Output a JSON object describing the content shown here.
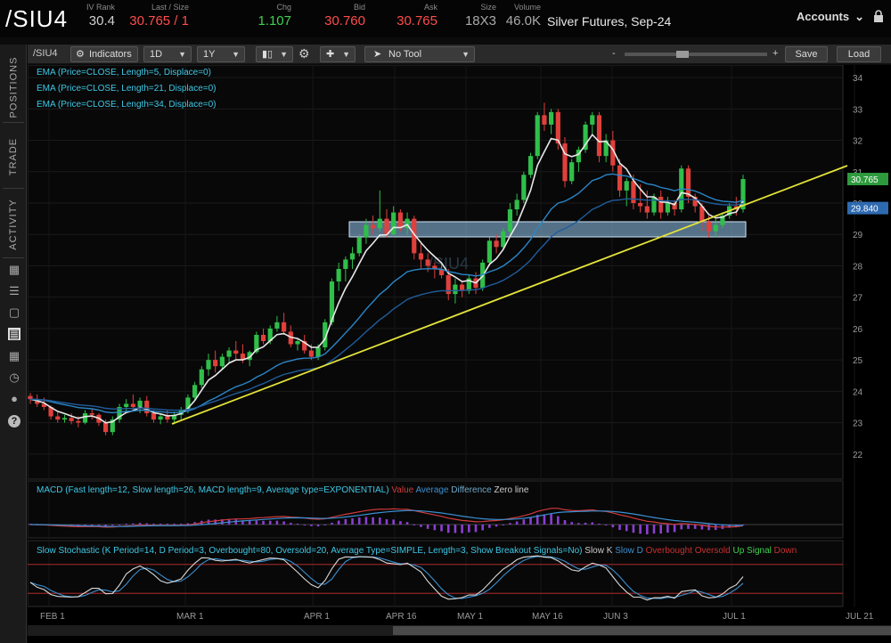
{
  "header": {
    "symbol": "/SIU4",
    "fields": [
      {
        "label": "IV Rank",
        "value": "30.4",
        "color": "#d0d0d0"
      },
      {
        "label": "Last / Size",
        "value": "30.765 / 1",
        "color": "#ff4c4c"
      },
      {
        "label": "Chg",
        "value": "1.107",
        "color": "#3fd04f"
      },
      {
        "label": "Bid",
        "value": "30.760",
        "color": "#ff4c4c"
      },
      {
        "label": "Ask",
        "value": "30.765",
        "color": "#ff4c4c"
      },
      {
        "label": "Size",
        "value": "18X3",
        "color": "#aaaaaa"
      },
      {
        "label": "Volume",
        "value": "46.0K",
        "color": "#aaaaaa"
      }
    ],
    "description": "Silver Futures, Sep-24",
    "accounts_label": "Accounts"
  },
  "left_rail": {
    "tabs": [
      "POSITIONS",
      "TRADE",
      "ACTIVITY"
    ],
    "icons": [
      "calculator-icon",
      "list-icon",
      "tv-icon",
      "chart-icon",
      "grid-icon",
      "gauge-icon",
      "people-icon",
      "help-icon"
    ]
  },
  "toolbar": {
    "symbol": "/SIU4",
    "indicators_label": "Indicators",
    "interval": "1D",
    "range": "1Y",
    "tool": "No Tool",
    "zoom_minus": "-",
    "zoom_plus": "+",
    "save_label": "Save",
    "load_label": "Load"
  },
  "studies": {
    "ema": [
      {
        "text": "EMA (Price=CLOSE, Length=5, Displace=0)",
        "color": "#3ec8e6"
      },
      {
        "text": "EMA (Price=CLOSE, Length=21, Displace=0)",
        "color": "#3ec8e6"
      },
      {
        "text": "EMA (Price=CLOSE, Length=34, Displace=0)",
        "color": "#3ec8e6"
      }
    ],
    "watermark": "/SIU4",
    "macd_title": "MACD (Fast length=12, Slow length=26, MACD length=9, Average type=EXPONENTIAL)",
    "macd_legend": [
      {
        "text": "Value",
        "color": "#d03b3b"
      },
      {
        "text": "Average",
        "color": "#3b8fd0"
      },
      {
        "text": "Difference",
        "color": "#6fa8c8"
      },
      {
        "text": "Zero line",
        "color": "#cccccc"
      }
    ],
    "stoch_title": "Slow Stochastic (K Period=14, D Period=3, Overbought=80, Oversold=20, Average Type=SIMPLE, Length=3, Show Breakout Signals=No)",
    "stoch_legend": [
      {
        "text": "Slow K",
        "color": "#cccccc"
      },
      {
        "text": "Slow D",
        "color": "#3b8fd0"
      },
      {
        "text": "Overbought",
        "color": "#c83030"
      },
      {
        "text": "Oversold",
        "color": "#c83030"
      },
      {
        "text": "Up Signal",
        "color": "#3fd04f"
      },
      {
        "text": "Down",
        "color": "#c83030"
      }
    ]
  },
  "chart_data": {
    "type": "candlestick",
    "instrument": "/SIU4",
    "ylim": [
      21.2,
      34.4
    ],
    "y_ticks": [
      22,
      23,
      24,
      25,
      26,
      27,
      28,
      29,
      30,
      31,
      32,
      33,
      34
    ],
    "x_labels": [
      "FEB 1",
      "MAR 1",
      "APR 1",
      "APR 16",
      "MAY 1",
      "MAY 16",
      "JUN 3",
      "JUL 1",
      "JUL 21"
    ],
    "price_badges": [
      {
        "value": "30.765",
        "color": "#2e9a3e"
      },
      {
        "value": "29.840",
        "color": "#2e6ab0"
      }
    ],
    "candles": [
      [
        23.85,
        23.95,
        23.6,
        23.75
      ],
      [
        23.75,
        23.9,
        23.5,
        23.6
      ],
      [
        23.6,
        23.8,
        23.4,
        23.5
      ],
      [
        23.5,
        23.55,
        23.1,
        23.2
      ],
      [
        23.2,
        23.35,
        23.0,
        23.1
      ],
      [
        23.1,
        23.25,
        23.0,
        23.15
      ],
      [
        23.15,
        23.3,
        22.95,
        23.05
      ],
      [
        23.05,
        23.2,
        22.85,
        23.0
      ],
      [
        23.0,
        23.4,
        22.95,
        23.3
      ],
      [
        23.3,
        23.45,
        23.1,
        23.25
      ],
      [
        23.25,
        23.3,
        22.9,
        23.0
      ],
      [
        23.0,
        23.1,
        22.6,
        22.7
      ],
      [
        22.7,
        23.2,
        22.6,
        23.1
      ],
      [
        23.1,
        23.6,
        23.0,
        23.5
      ],
      [
        23.5,
        23.75,
        23.3,
        23.6
      ],
      [
        23.6,
        23.9,
        23.4,
        23.5
      ],
      [
        23.5,
        23.8,
        23.3,
        23.7
      ],
      [
        23.7,
        23.85,
        23.2,
        23.3
      ],
      [
        23.3,
        23.4,
        23.0,
        23.1
      ],
      [
        23.1,
        23.3,
        22.95,
        23.2
      ],
      [
        23.2,
        23.4,
        23.0,
        23.1
      ],
      [
        23.1,
        23.35,
        22.95,
        23.25
      ],
      [
        23.25,
        23.5,
        23.1,
        23.4
      ],
      [
        23.4,
        23.9,
        23.3,
        23.8
      ],
      [
        23.8,
        24.3,
        23.7,
        24.2
      ],
      [
        24.2,
        24.8,
        24.1,
        24.7
      ],
      [
        24.7,
        25.2,
        24.5,
        25.0
      ],
      [
        25.0,
        25.3,
        24.6,
        24.8
      ],
      [
        24.8,
        25.2,
        24.7,
        25.1
      ],
      [
        25.1,
        25.4,
        24.9,
        25.3
      ],
      [
        25.3,
        25.6,
        25.0,
        25.2
      ],
      [
        25.2,
        25.5,
        24.9,
        25.0
      ],
      [
        25.0,
        25.3,
        24.8,
        25.25
      ],
      [
        25.25,
        25.9,
        25.2,
        25.8
      ],
      [
        25.8,
        26.0,
        25.5,
        25.6
      ],
      [
        25.6,
        26.1,
        25.5,
        26.0
      ],
      [
        26.0,
        26.4,
        25.9,
        26.2
      ],
      [
        26.2,
        26.5,
        25.8,
        25.9
      ],
      [
        25.9,
        26.1,
        25.4,
        25.5
      ],
      [
        25.5,
        25.7,
        25.3,
        25.6
      ],
      [
        25.6,
        25.8,
        25.2,
        25.3
      ],
      [
        25.3,
        25.5,
        25.0,
        25.1
      ],
      [
        25.1,
        25.5,
        25.0,
        25.4
      ],
      [
        25.4,
        26.3,
        25.3,
        26.2
      ],
      [
        26.2,
        27.6,
        26.1,
        27.5
      ],
      [
        27.5,
        28.1,
        27.2,
        27.9
      ],
      [
        27.9,
        28.3,
        27.5,
        28.2
      ],
      [
        28.2,
        28.6,
        27.9,
        28.4
      ],
      [
        28.4,
        29.0,
        28.3,
        28.9
      ],
      [
        28.9,
        29.5,
        28.7,
        29.3
      ],
      [
        29.3,
        29.6,
        29.0,
        29.2
      ],
      [
        29.2,
        30.4,
        29.1,
        29.5
      ],
      [
        29.5,
        29.8,
        28.9,
        29.0
      ],
      [
        29.0,
        29.9,
        28.9,
        29.7
      ],
      [
        29.7,
        29.8,
        29.1,
        29.2
      ],
      [
        29.2,
        29.7,
        29.0,
        29.5
      ],
      [
        29.5,
        29.6,
        28.2,
        28.4
      ],
      [
        28.4,
        28.7,
        27.9,
        28.2
      ],
      [
        28.2,
        28.4,
        27.8,
        28.0
      ],
      [
        28.0,
        28.1,
        27.6,
        27.9
      ],
      [
        27.9,
        28.1,
        27.6,
        27.7
      ],
      [
        27.7,
        27.9,
        26.9,
        27.1
      ],
      [
        27.1,
        27.6,
        26.8,
        27.4
      ],
      [
        27.4,
        27.5,
        27.0,
        27.2
      ],
      [
        27.2,
        27.7,
        27.1,
        27.6
      ],
      [
        27.6,
        27.8,
        27.1,
        27.3
      ],
      [
        27.3,
        28.2,
        27.2,
        28.1
      ],
      [
        28.1,
        28.9,
        28.0,
        28.8
      ],
      [
        28.8,
        29.0,
        28.4,
        28.6
      ],
      [
        28.6,
        29.2,
        28.5,
        29.1
      ],
      [
        29.1,
        30.0,
        29.0,
        29.8
      ],
      [
        29.8,
        30.3,
        29.6,
        30.1
      ],
      [
        30.1,
        31.0,
        30.0,
        30.9
      ],
      [
        30.9,
        31.6,
        30.8,
        31.5
      ],
      [
        31.5,
        32.9,
        31.4,
        32.8
      ],
      [
        32.8,
        33.2,
        32.3,
        32.5
      ],
      [
        32.5,
        33.0,
        32.2,
        32.9
      ],
      [
        32.9,
        33.0,
        31.7,
        31.9
      ],
      [
        31.9,
        32.1,
        30.5,
        30.7
      ],
      [
        30.7,
        31.4,
        30.6,
        31.3
      ],
      [
        31.3,
        31.8,
        31.0,
        31.7
      ],
      [
        31.7,
        32.6,
        31.6,
        32.5
      ],
      [
        32.5,
        32.9,
        32.2,
        32.8
      ],
      [
        32.8,
        32.9,
        31.3,
        31.5
      ],
      [
        31.5,
        32.2,
        31.3,
        32.0
      ],
      [
        32.0,
        32.3,
        31.0,
        31.2
      ],
      [
        31.2,
        31.4,
        30.2,
        30.4
      ],
      [
        30.4,
        30.8,
        29.9,
        30.7
      ],
      [
        30.7,
        30.9,
        29.8,
        30.0
      ],
      [
        30.0,
        30.6,
        29.7,
        29.9
      ],
      [
        29.9,
        30.4,
        29.5,
        29.7
      ],
      [
        29.7,
        30.3,
        29.6,
        30.2
      ],
      [
        30.2,
        30.4,
        29.5,
        29.7
      ],
      [
        29.7,
        30.2,
        29.6,
        30.0
      ],
      [
        30.0,
        30.1,
        29.6,
        29.8
      ],
      [
        29.8,
        31.2,
        29.7,
        31.1
      ],
      [
        31.1,
        31.2,
        30.0,
        30.2
      ],
      [
        30.2,
        30.3,
        29.7,
        29.9
      ],
      [
        29.9,
        30.0,
        29.1,
        29.4
      ],
      [
        29.4,
        29.6,
        28.9,
        29.1
      ],
      [
        29.1,
        29.5,
        28.9,
        29.3
      ],
      [
        29.3,
        29.7,
        29.2,
        29.6
      ],
      [
        29.6,
        30.0,
        29.5,
        29.9
      ],
      [
        29.9,
        30.2,
        29.6,
        29.8
      ],
      [
        29.8,
        30.9,
        29.7,
        30.765
      ]
    ]
  }
}
